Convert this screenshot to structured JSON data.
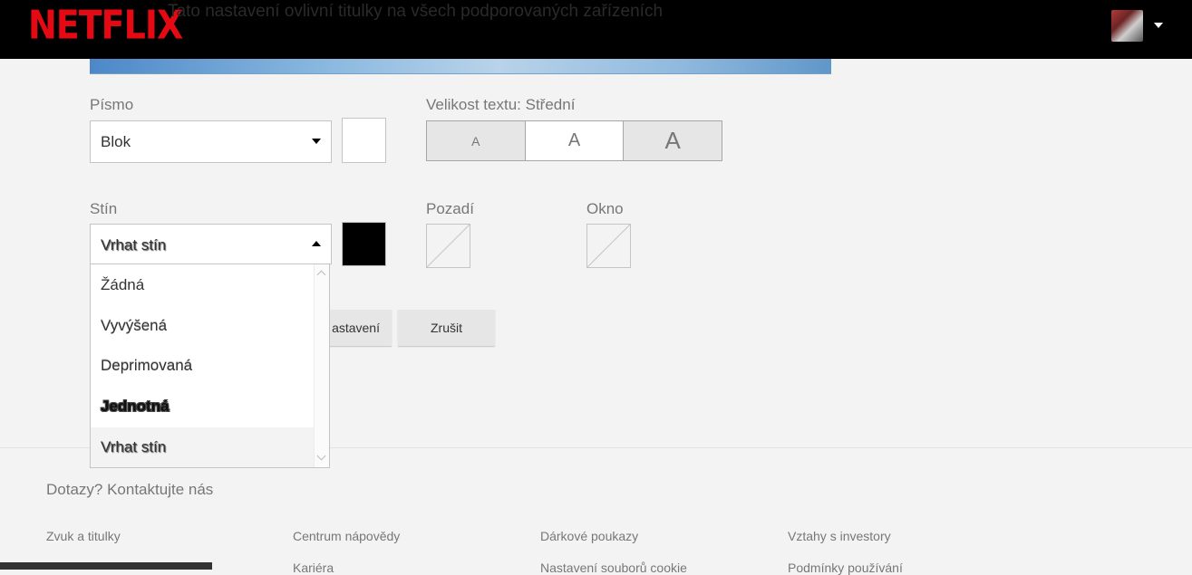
{
  "header": {
    "logo_text": "NETFLIX",
    "ghost_text": "Tato nastavení ovlivní titulky na všech podporovaných zařízeních"
  },
  "font": {
    "label": "Písmo",
    "value": "Blok",
    "color": "#ffffff"
  },
  "text_size": {
    "label": "Velikost textu: Střední",
    "options": [
      "A",
      "A",
      "A"
    ],
    "selected_index": 1
  },
  "shadow": {
    "label": "Stín",
    "value": "Vrhat stín",
    "color": "#000000",
    "options": [
      "Žádná",
      "Vyvýšená",
      "Deprimovaná",
      "Jednotná",
      "Vrhat stín"
    ],
    "selected_index": 4
  },
  "background": {
    "label": "Pozadí"
  },
  "window": {
    "label": "Okno"
  },
  "buttons": {
    "save": "astavení",
    "cancel": "Zrušit"
  },
  "footer": {
    "contact": "Dotazy? Kontaktujte nás",
    "links": [
      "Zvuk a titulky",
      "Centrum nápovědy",
      "Dárkové poukazy",
      "Vztahy s investory",
      "Kariéra",
      "Nastavení souborů cookie",
      "Podmínky používání"
    ]
  }
}
